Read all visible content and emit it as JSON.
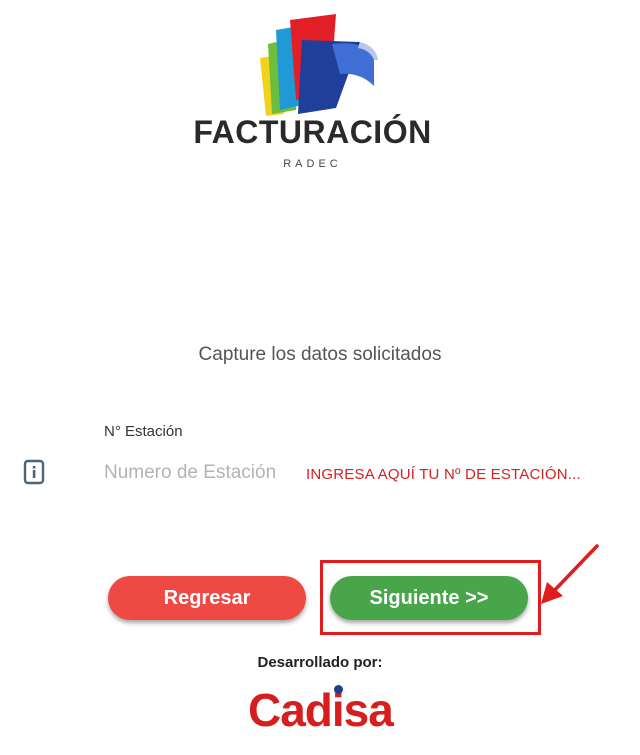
{
  "header": {
    "logo_title": "FACTURACIÓN",
    "logo_subtitle": "RADEC"
  },
  "form": {
    "instruction": "Capture los datos solicitados",
    "station_label": "N° Estación",
    "station_placeholder": "Numero de Estación",
    "station_value": "",
    "station_icon": "info-icon"
  },
  "annotation": {
    "text": "INGRESA AQUÍ TU Nº DE ESTACIÓN...",
    "color": "#d22222"
  },
  "buttons": {
    "back_label": "Regresar",
    "next_label": "Siguiente >>",
    "back_color": "#ee4a43",
    "next_color": "#49a54a"
  },
  "footer": {
    "developed_by": "Desarrollado por:",
    "brand": "Cadisa"
  }
}
